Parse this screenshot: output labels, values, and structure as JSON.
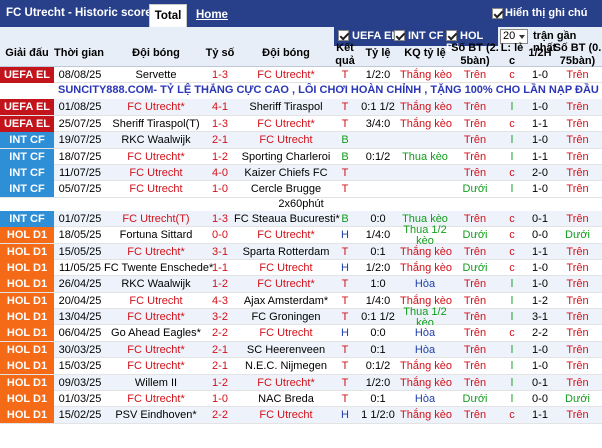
{
  "header": {
    "title": "FC Utrecht - Historic scores",
    "tab_total": "Total",
    "tab_home": "Home",
    "show_notes": "Hiển thị ghi chú"
  },
  "filters": {
    "uefa": "UEFA EL",
    "intcf": "INT CF",
    "hol": "HOL D1",
    "count": "20",
    "last_label": "trận gần nhất"
  },
  "columns": {
    "league": "Giải đấu",
    "date": "Thời gian",
    "home": "Đội bóng",
    "score": "Tỷ số",
    "away": "Đội bóng",
    "result_l1": "Kết",
    "result_l2": "quả",
    "odds": "Tỷ lệ",
    "odds_result": "KQ tỷ lệ",
    "goals_l1": "Số BT (2.",
    "goals_l2": "5bàn)",
    "oddeven_l1": "L: lẻ",
    "oddeven_l2": "c",
    "half": "1/2H",
    "goals75_l1": "Số BT (0.",
    "goals75_l2": "75bàn)"
  },
  "ad_text": "SUNCITY888.COM- TỶ LỆ THẮNG CỰC CAO , LÔI CHƠI HOÀN CHỈNH , TẶNG 100% CHO LẦN NẠP ĐẦU",
  "note_2x60": "2x60phút",
  "colors": {
    "navy": "#28408a",
    "uefa": "#c3141c",
    "intcf": "#2e8fd6",
    "hol": "#f46a16",
    "red": "#d21019",
    "green": "#119c1c"
  },
  "matches": [
    {
      "league": "UEFA EL",
      "date": "08/08/25",
      "home": "Servette",
      "score": "1-3",
      "away": "FC Utrecht*",
      "res": "T",
      "odds": "1/2:0",
      "kq": "Thắng kèo",
      "bt": "Trên",
      "le": "c",
      "h": "1-0",
      "bt75": "Trên"
    },
    {
      "league": "UEFA EL",
      "date": "01/08/25",
      "home": "FC Utrecht*",
      "score": "4-1",
      "away": "Sheriff Tiraspol",
      "res": "T",
      "odds": "0:1 1/2",
      "kq": "Thắng kèo",
      "bt": "Trên",
      "le": "l",
      "h": "1-0",
      "bt75": "Trên"
    },
    {
      "league": "UEFA EL",
      "date": "25/07/25",
      "home": "Sheriff Tiraspol(T)",
      "score": "1-3",
      "away": "FC Utrecht*",
      "res": "T",
      "odds": "3/4:0",
      "kq": "Thắng kèo",
      "bt": "Trên",
      "le": "c",
      "h": "1-1",
      "bt75": "Trên"
    },
    {
      "league": "INT CF",
      "date": "19/07/25",
      "home": "RKC Waalwijk",
      "score": "2-1",
      "away": "FC Utrecht",
      "res": "B",
      "odds": "",
      "kq": "",
      "bt": "Trên",
      "le": "l",
      "h": "1-0",
      "bt75": "Trên"
    },
    {
      "league": "INT CF",
      "date": "18/07/25",
      "home": "FC Utrecht*",
      "score": "1-2",
      "away": "Sporting Charleroi",
      "res": "B",
      "odds": "0:1/2",
      "kq": "Thua kèo",
      "bt": "Trên",
      "le": "l",
      "h": "1-1",
      "bt75": "Trên"
    },
    {
      "league": "INT CF",
      "date": "11/07/25",
      "home": "FC Utrecht",
      "score": "4-0",
      "away": "Kaizer Chiefs FC",
      "res": "T",
      "odds": "",
      "kq": "",
      "bt": "Trên",
      "le": "c",
      "h": "2-0",
      "bt75": "Trên"
    },
    {
      "league": "INT CF",
      "date": "05/07/25",
      "home": "FC Utrecht",
      "score": "1-0",
      "away": "Cercle Brugge",
      "res": "T",
      "odds": "",
      "kq": "",
      "bt": "Dưới",
      "le": "l",
      "h": "1-0",
      "bt75": "Trên"
    },
    {
      "league": "INT CF",
      "date": "01/07/25",
      "home": "FC Utrecht(T)",
      "score": "1-3",
      "away": "FC Steaua Bucuresti*",
      "res": "B",
      "odds": "0:0",
      "kq": "Thua kèo",
      "bt": "Trên",
      "le": "c",
      "h": "0-1",
      "bt75": "Trên"
    },
    {
      "league": "HOL D1",
      "date": "18/05/25",
      "home": "Fortuna Sittard",
      "score": "0-0",
      "away": "FC Utrecht*",
      "res": "H",
      "odds": "1/4:0",
      "kq": "Thua 1/2 kèo",
      "bt": "Dưới",
      "le": "c",
      "h": "0-0",
      "bt75": "Dưới"
    },
    {
      "league": "HOL D1",
      "date": "15/05/25",
      "home": "FC Utrecht*",
      "score": "3-1",
      "away": "Sparta Rotterdam",
      "res": "T",
      "odds": "0:1",
      "kq": "Thắng kèo",
      "bt": "Trên",
      "le": "c",
      "h": "1-1",
      "bt75": "Trên"
    },
    {
      "league": "HOL D1",
      "date": "11/05/25",
      "home": "FC Twente Enschede*",
      "score": "1-1",
      "away": "FC Utrecht",
      "res": "H",
      "odds": "1/2:0",
      "kq": "Thắng kèo",
      "bt": "Dưới",
      "le": "c",
      "h": "1-0",
      "bt75": "Trên"
    },
    {
      "league": "HOL D1",
      "date": "26/04/25",
      "home": "RKC Waalwijk",
      "score": "1-2",
      "away": "FC Utrecht*",
      "res": "T",
      "odds": "1:0",
      "kq": "Hòa",
      "bt": "Trên",
      "le": "l",
      "h": "1-0",
      "bt75": "Trên"
    },
    {
      "league": "HOL D1",
      "date": "20/04/25",
      "home": "FC Utrecht",
      "score": "4-3",
      "away": "Ajax Amsterdam*",
      "res": "T",
      "odds": "1/4:0",
      "kq": "Thắng kèo",
      "bt": "Trên",
      "le": "l",
      "h": "1-2",
      "bt75": "Trên"
    },
    {
      "league": "HOL D1",
      "date": "13/04/25",
      "home": "FC Utrecht*",
      "score": "3-2",
      "away": "FC Groningen",
      "res": "T",
      "odds": "0:1 1/2",
      "kq": "Thua 1/2 kèo",
      "bt": "Trên",
      "le": "l",
      "h": "3-1",
      "bt75": "Trên"
    },
    {
      "league": "HOL D1",
      "date": "06/04/25",
      "home": "Go Ahead Eagles*",
      "score": "2-2",
      "away": "FC Utrecht",
      "res": "H",
      "odds": "0:0",
      "kq": "Hòa",
      "bt": "Trên",
      "le": "c",
      "h": "2-2",
      "bt75": "Trên"
    },
    {
      "league": "HOL D1",
      "date": "30/03/25",
      "home": "FC Utrecht*",
      "score": "2-1",
      "away": "SC Heerenveen",
      "res": "T",
      "odds": "0:1",
      "kq": "Hòa",
      "bt": "Trên",
      "le": "l",
      "h": "1-0",
      "bt75": "Trên"
    },
    {
      "league": "HOL D1",
      "date": "15/03/25",
      "home": "FC Utrecht*",
      "score": "2-1",
      "away": "N.E.C. Nijmegen",
      "res": "T",
      "odds": "0:1/2",
      "kq": "Thắng kèo",
      "bt": "Trên",
      "le": "l",
      "h": "1-0",
      "bt75": "Trên"
    },
    {
      "league": "HOL D1",
      "date": "09/03/25",
      "home": "Willem II",
      "score": "1-2",
      "away": "FC Utrecht*",
      "res": "T",
      "odds": "1/2:0",
      "kq": "Thắng kèo",
      "bt": "Trên",
      "le": "l",
      "h": "0-1",
      "bt75": "Trên"
    },
    {
      "league": "HOL D1",
      "date": "01/03/25",
      "home": "FC Utrecht*",
      "score": "1-0",
      "away": "NAC Breda",
      "res": "T",
      "odds": "0:1",
      "kq": "Hòa",
      "bt": "Dưới",
      "le": "l",
      "h": "0-0",
      "bt75": "Dưới"
    },
    {
      "league": "HOL D1",
      "date": "15/02/25",
      "home": "PSV Eindhoven*",
      "score": "2-2",
      "away": "FC Utrecht",
      "res": "H",
      "odds": "1 1/2:0",
      "kq": "Thắng kèo",
      "bt": "Trên",
      "le": "c",
      "h": "1-1",
      "bt75": "Trên"
    }
  ]
}
